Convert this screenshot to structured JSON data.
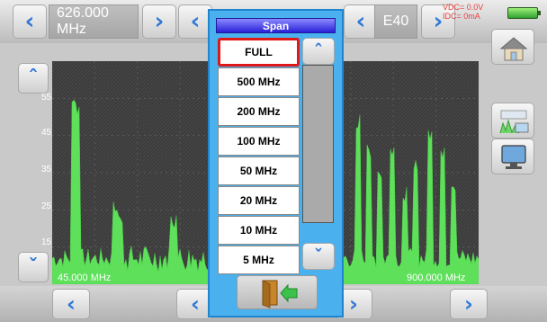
{
  "top_bar": {
    "frequency": "626.000 MHz",
    "channel": "E40"
  },
  "status": {
    "vdc": "VDC= 0.0V",
    "idc": "IDC= 0mA"
  },
  "spectrum": {
    "y_labels": [
      "55",
      "45",
      "35",
      "25",
      "15"
    ],
    "start_freq": "45.000 MHz",
    "stop_freq": "900.000 MHz"
  },
  "span_menu": {
    "title": "Span",
    "options": [
      "FULL",
      "500 MHz",
      "200 MHz",
      "100 MHz",
      "50 MHz",
      "20 MHz",
      "10 MHz",
      "5 MHz"
    ],
    "selected": "FULL"
  },
  "icons": {
    "left_arrow": "chevron-left-icon",
    "right_arrow": "chevron-right-icon",
    "up_arrow": "chevron-up-icon",
    "down_arrow": "chevron-down-icon",
    "home": "home-icon",
    "exit": "exit-door-icon",
    "battery": "battery-icon",
    "spectrum_mode": "spectrum-mode-icon",
    "tv_monitor": "tv-monitor-icon"
  },
  "colors": {
    "popup_border": "#4ab0ee",
    "title_bar": "#2a1fd6",
    "selection": "#e01818",
    "trace": "#5ee05a",
    "arrow": "#2f78d8",
    "status_text": "#e84040"
  }
}
